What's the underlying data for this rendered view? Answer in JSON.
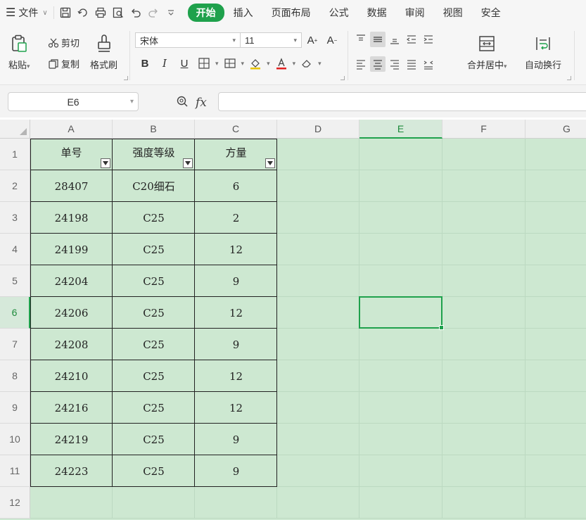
{
  "menubar": {
    "file_label": "文件",
    "tabs": [
      {
        "label": "开始",
        "active": true
      },
      {
        "label": "插入"
      },
      {
        "label": "页面布局"
      },
      {
        "label": "公式"
      },
      {
        "label": "数据"
      },
      {
        "label": "审阅"
      },
      {
        "label": "视图"
      },
      {
        "label": "安全"
      }
    ]
  },
  "ribbon": {
    "paste": "粘贴",
    "cut": "剪切",
    "copy": "复制",
    "format_painter": "格式刷",
    "font_name": "宋体",
    "font_size": "11",
    "merge_center": "合并居中",
    "wrap_text": "自动换行"
  },
  "formula_bar": {
    "cell_ref": "E6",
    "formula": ""
  },
  "grid": {
    "columns": [
      "A",
      "B",
      "C",
      "D",
      "E",
      "F",
      "G"
    ],
    "rows": [
      "1",
      "2",
      "3",
      "4",
      "5",
      "6",
      "7",
      "8",
      "9",
      "10",
      "11",
      "12"
    ],
    "selected_column": "E",
    "selected_row": "6",
    "headers": [
      "单号",
      "强度等级",
      "方量"
    ],
    "data": [
      [
        "28407",
        "C20细石",
        "6"
      ],
      [
        "24198",
        "C25",
        "2"
      ],
      [
        "24199",
        "C25",
        "12"
      ],
      [
        "24204",
        "C25",
        "9"
      ],
      [
        "24206",
        "C25",
        "12"
      ],
      [
        "24208",
        "C25",
        "9"
      ],
      [
        "24210",
        "C25",
        "12"
      ],
      [
        "24216",
        "C25",
        "12"
      ],
      [
        "24219",
        "C25",
        "9"
      ],
      [
        "24223",
        "C25",
        "9"
      ]
    ]
  },
  "colors": {
    "accent": "#1fa14c",
    "grid_background": "#cde8d1"
  }
}
